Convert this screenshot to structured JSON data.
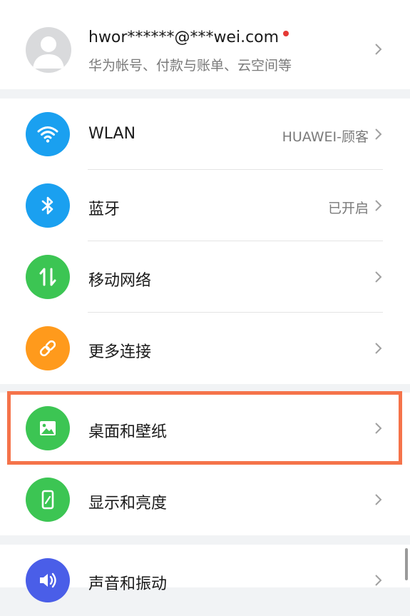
{
  "account": {
    "email": "hwor******@***wei.com",
    "subtitle": "华为帐号、付款与账单、云空间等",
    "avatar_icon": "avatar-placeholder-icon"
  },
  "settings": {
    "wlan": {
      "label": "WLAN",
      "value": "HUAWEI-顾客",
      "icon": "wifi-icon",
      "color": "#1aa0f0"
    },
    "bluetooth": {
      "label": "蓝牙",
      "value": "已开启",
      "icon": "bluetooth-icon",
      "color": "#1aa0f0"
    },
    "mobile": {
      "label": "移动网络",
      "icon": "mobile-data-icon",
      "color": "#3cc553"
    },
    "more": {
      "label": "更多连接",
      "icon": "link-icon",
      "color": "#ff9a1c"
    },
    "desktop": {
      "label": "桌面和壁纸",
      "icon": "image-icon",
      "color": "#3cc553"
    },
    "display": {
      "label": "显示和亮度",
      "icon": "phone-brightness-icon",
      "color": "#3cc553"
    },
    "sound": {
      "label": "声音和振动",
      "icon": "speaker-icon",
      "color": "#4a5ee8"
    }
  },
  "highlight_color": "#f5734a"
}
